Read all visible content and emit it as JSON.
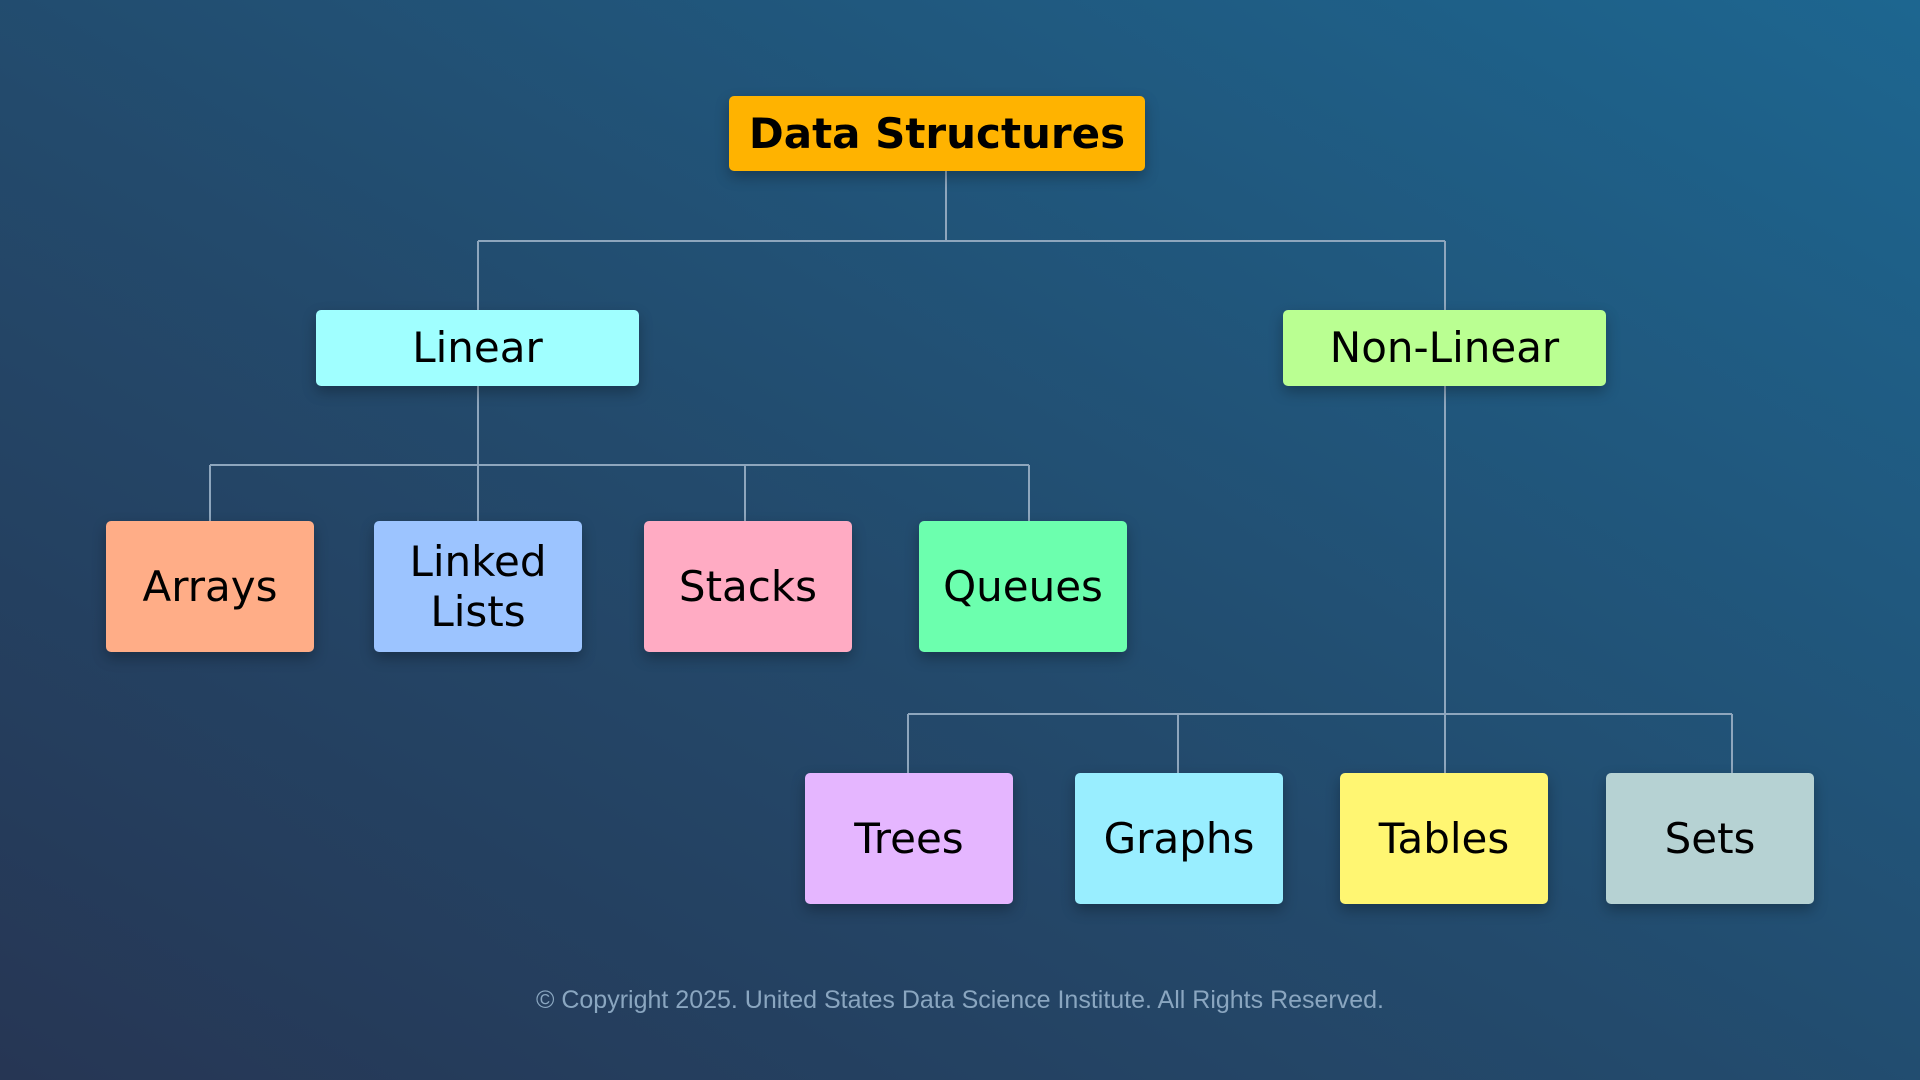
{
  "diagram": {
    "type": "tree",
    "root": {
      "id": "root",
      "label": "Data Structures",
      "color": "#FFB300"
    },
    "categories": [
      {
        "id": "linear",
        "label": "Linear",
        "color": "#A0FFFF",
        "children": [
          {
            "id": "arrays",
            "label": "Arrays",
            "color": "#FFAD87"
          },
          {
            "id": "linked-lists",
            "label": "Linked Lists",
            "color": "#9CC4FF"
          },
          {
            "id": "stacks",
            "label": "Stacks",
            "color": "#FFABC3"
          },
          {
            "id": "queues",
            "label": "Queues",
            "color": "#6CFFAE"
          }
        ]
      },
      {
        "id": "non-linear",
        "label": "Non-Linear",
        "color": "#BAFF92",
        "children": [
          {
            "id": "trees",
            "label": "Trees",
            "color": "#E5B6FF"
          },
          {
            "id": "graphs",
            "label": "Graphs",
            "color": "#99EEFF"
          },
          {
            "id": "tables",
            "label": "Tables",
            "color": "#FFF672"
          },
          {
            "id": "sets",
            "label": "Sets",
            "color": "#B6D2D3"
          }
        ]
      }
    ],
    "connector_color": "#8EA6BD"
  },
  "footer": {
    "copyright": "© Copyright 2025. United States Data Science Institute. All Rights Reserved."
  }
}
